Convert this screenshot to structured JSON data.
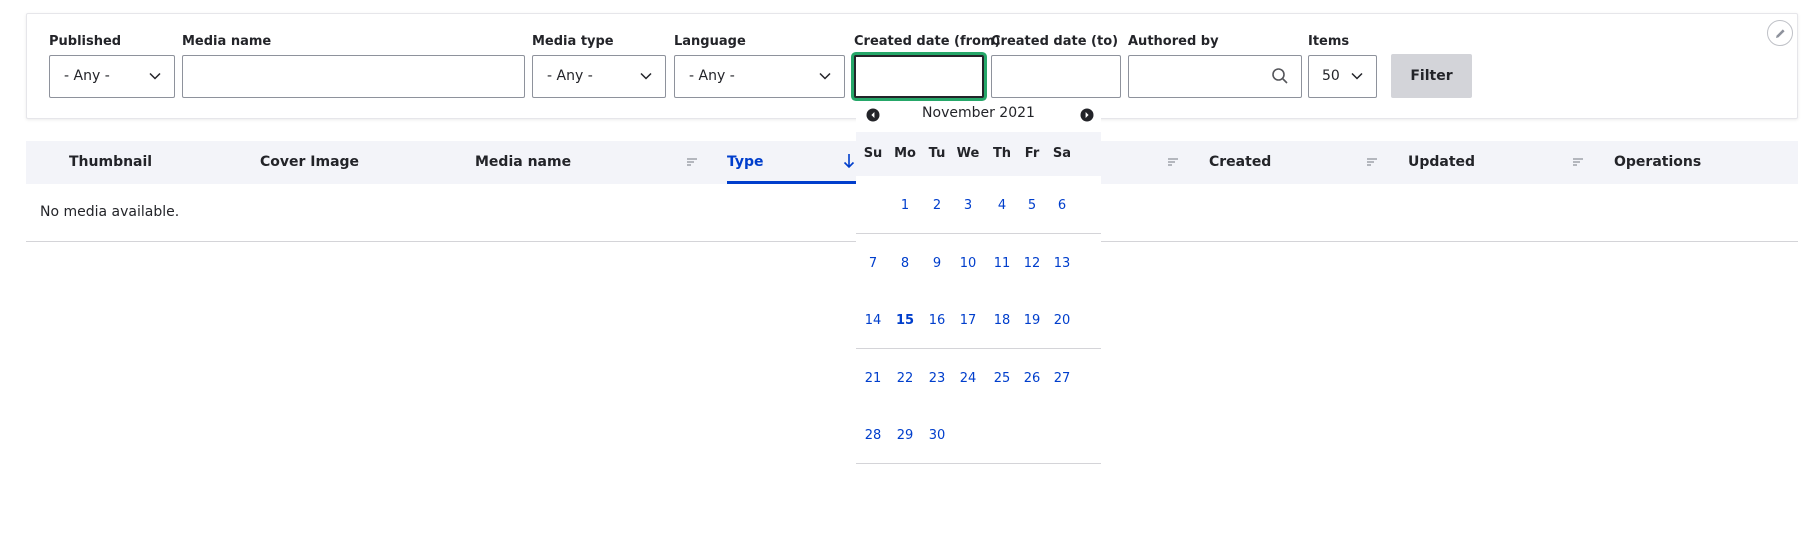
{
  "filters": {
    "published": {
      "label": "Published",
      "value": "- Any -"
    },
    "media_name": {
      "label": "Media name",
      "value": ""
    },
    "media_type": {
      "label": "Media type",
      "value": "- Any -"
    },
    "language": {
      "label": "Language",
      "value": "- Any -"
    },
    "created_from": {
      "label": "Created date (from)",
      "value": ""
    },
    "created_to": {
      "label": "Created date (to)",
      "value": ""
    },
    "authored_by": {
      "label": "Authored by",
      "value": ""
    },
    "items": {
      "label": "Items",
      "value": "50"
    },
    "filter_button": "Filter"
  },
  "table": {
    "columns": [
      "Thumbnail",
      "Cover Image",
      "Media name",
      "Type",
      "Created",
      "Updated",
      "Operations"
    ],
    "active_sort_column": "Type",
    "empty_message": "No media available."
  },
  "datepicker": {
    "month_label": "November 2021",
    "weekdays": [
      "Su",
      "Mo",
      "Tu",
      "We",
      "Th",
      "Fr",
      "Sa"
    ],
    "weeks": [
      [
        "",
        "1",
        "2",
        "3",
        "4",
        "5",
        "6"
      ],
      [
        "7",
        "8",
        "9",
        "10",
        "11",
        "12",
        "13"
      ],
      [
        "14",
        "15",
        "16",
        "17",
        "18",
        "19",
        "20"
      ],
      [
        "21",
        "22",
        "23",
        "24",
        "25",
        "26",
        "27"
      ],
      [
        "28",
        "29",
        "30",
        "",
        "",
        "",
        ""
      ]
    ],
    "today": "15"
  },
  "colors": {
    "link_blue": "#003ecc",
    "focus_green": "#26a769",
    "button_grey": "#d3d4d9",
    "header_bg": "#f3f4f9"
  },
  "icons": {
    "select": "chevron-down-icon",
    "search": "search-icon",
    "sort": "sort-icon",
    "sort_active": "arrow-down-icon",
    "edit": "pencil-icon",
    "prev": "prev-month-icon",
    "next": "next-month-icon"
  }
}
